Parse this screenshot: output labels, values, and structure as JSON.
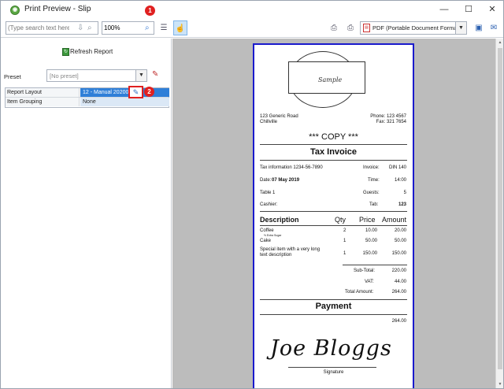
{
  "window": {
    "title": "Print Preview - Slip",
    "controls": {
      "minimize": "—",
      "maximize": "☐",
      "close": "✕"
    }
  },
  "markers": {
    "one": "1",
    "two": "2"
  },
  "toolbar": {
    "search_placeholder": "(Type search text here)",
    "zoom_value": "100%",
    "printer": "PDF (Portable Document Format)"
  },
  "left_panel": {
    "refresh_label": "Refresh Report",
    "preset_label": "Preset",
    "preset_value": "[No preset]",
    "properties": [
      {
        "key": "Report Layout",
        "value": "12 - Manual 20200"
      },
      {
        "key": "Item Grouping",
        "value": "None"
      }
    ]
  },
  "receipt": {
    "logo_text": "Sample",
    "address": [
      "123 Generic Road",
      "Chillville"
    ],
    "phone": "Phone: 123 4567",
    "fax": "Fax: 321 7654",
    "copy_label": "*** COPY ***",
    "heading": "Tax Invoice",
    "tax_info": "Tax information 1234-56-7890",
    "invoice_label": "Invoice:",
    "invoice_value": "DIN 140",
    "date_label": "Date:",
    "date_value": "07 May 2019",
    "time_label": "Time:",
    "time_value": "14:00",
    "table": "Table 1",
    "guests_label": "Guests:",
    "guests_value": "5",
    "cashier": "Cashier:",
    "tab_label": "Tab:",
    "tab_value": "123",
    "columns": {
      "description": "Description",
      "qty": "Qty",
      "price": "Price",
      "amount": "Amount"
    },
    "items": [
      {
        "description": "Coffee",
        "note": "½ Extra Sugar",
        "qty": "2",
        "price": "10.00",
        "amount": "20.00"
      },
      {
        "description": "Cake",
        "qty": "1",
        "price": "50.00",
        "amount": "50.00"
      },
      {
        "description": "Special item with a very long",
        "description2": "text description",
        "qty": "1",
        "price": "150.00",
        "amount": "150.00"
      }
    ],
    "subtotal_label": "Sub-Total:",
    "subtotal_value": "220.00",
    "vat_label": "VAT:",
    "vat_value": "44.00",
    "total_label": "Total Amount:",
    "total_value": "264.00",
    "payment_heading": "Payment",
    "payment_value": "264.00",
    "signature_text": "Joe Bloggs",
    "signature_label": "Signature"
  }
}
